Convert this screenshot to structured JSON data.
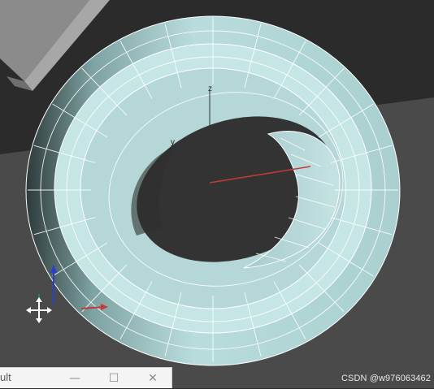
{
  "viewport": {
    "axis_labels": {
      "z": "z",
      "y": "y"
    }
  },
  "dialog": {
    "title": "ult",
    "minimize": "—",
    "maximize": "☐",
    "close": "✕"
  },
  "watermark": "CSDN @w976063462",
  "colors": {
    "background": "#2b2b2b",
    "ground": "#4b4b4b",
    "mesh_fill": "#b7dcdc",
    "wire": "#ffffff",
    "axis_x": "#c23b3b",
    "axis_y": "#2d8a3e",
    "axis_z": "#2a3fd0"
  }
}
